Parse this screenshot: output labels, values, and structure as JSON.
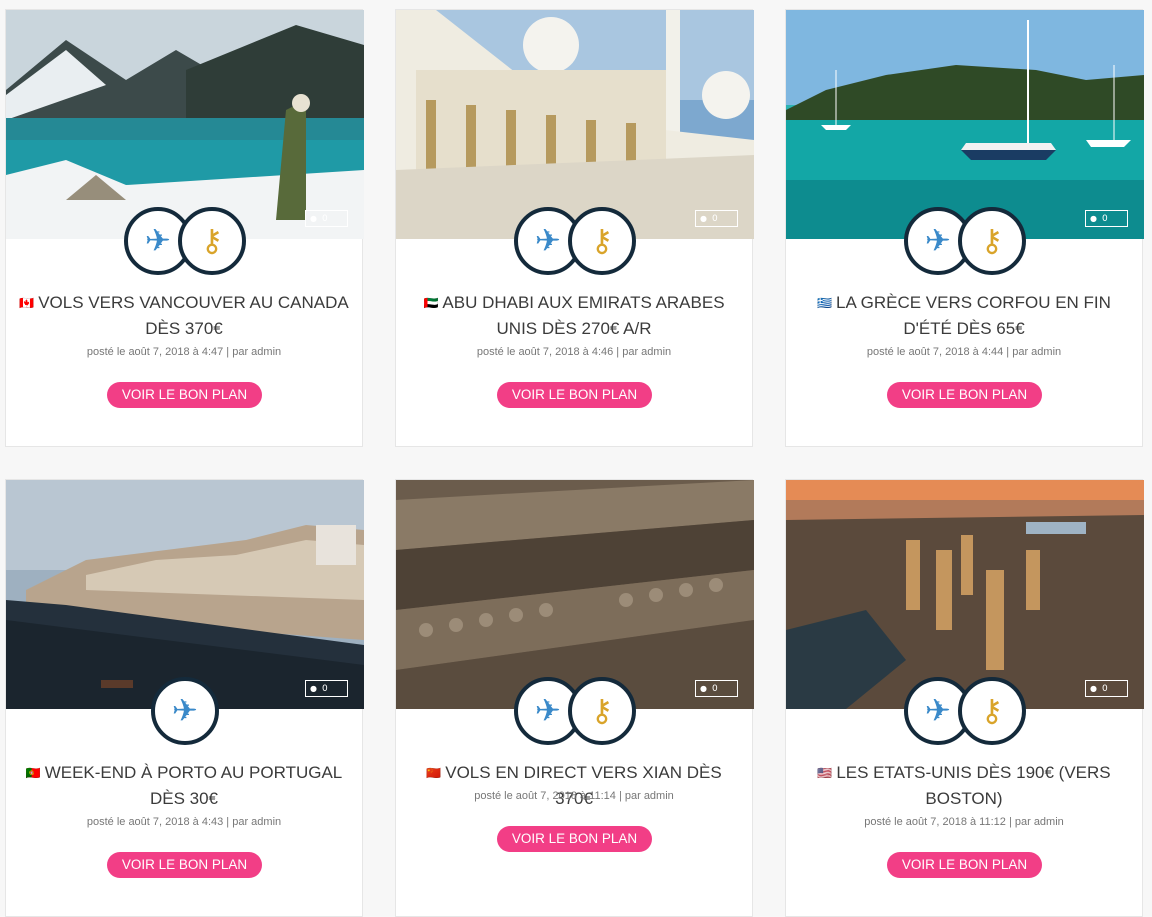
{
  "cards": [
    {
      "flag": "🇨🇦",
      "title": "VOLS VERS VANCOUVER AU CANADA DÈS 370€",
      "meta": "posté le août 7, 2018 à 4:47 | par admin",
      "comments": "0",
      "button": "VOIR LE BON PLAN",
      "icons": [
        "airplane-icon",
        "key-icon"
      ]
    },
    {
      "flag": "🇦🇪",
      "title": "ABU DHABI AUX EMIRATS ARABES UNIS DÈS 270€ A/R",
      "meta": "posté le août 7, 2018 à 4:46 | par admin",
      "comments": "0",
      "button": "VOIR LE BON PLAN",
      "icons": [
        "airplane-icon",
        "key-icon"
      ]
    },
    {
      "flag": "🇬🇷",
      "title": "LA GRÈCE VERS CORFOU EN FIN D'ÉTÉ DÈS 65€",
      "meta": "posté le août 7, 2018 à 4:44 | par admin",
      "comments": "0",
      "button": "VOIR LE BON PLAN",
      "icons": [
        "airplane-icon",
        "key-icon"
      ]
    },
    {
      "flag": "🇵🇹",
      "title": "WEEK-END À PORTO AU PORTUGAL DÈS 30€",
      "meta": "posté le août 7, 2018 à 4:43 | par admin",
      "comments": "0",
      "button": "VOIR LE BON PLAN",
      "icons": [
        "airplane-icon"
      ]
    },
    {
      "flag": "🇨🇳",
      "title": "VOLS EN DIRECT VERS XIAN DÈS 370€",
      "meta": "posté le août 7, 2018 à 11:14 | par admin",
      "comments": "0",
      "button": "VOIR LE BON PLAN",
      "icons": [
        "airplane-icon",
        "key-icon"
      ]
    },
    {
      "flag": "🇺🇸",
      "title": "LES ETATS-UNIS DÈS 190€ (VERS BOSTON)",
      "meta": "posté le août 7, 2018 à 11:12 | par admin",
      "comments": "0",
      "button": "VOIR LE BON PLAN",
      "icons": [
        "airplane-icon",
        "key-icon"
      ]
    }
  ],
  "colors": {
    "button": "#f23e86",
    "icon_ring": "#142a3b"
  }
}
